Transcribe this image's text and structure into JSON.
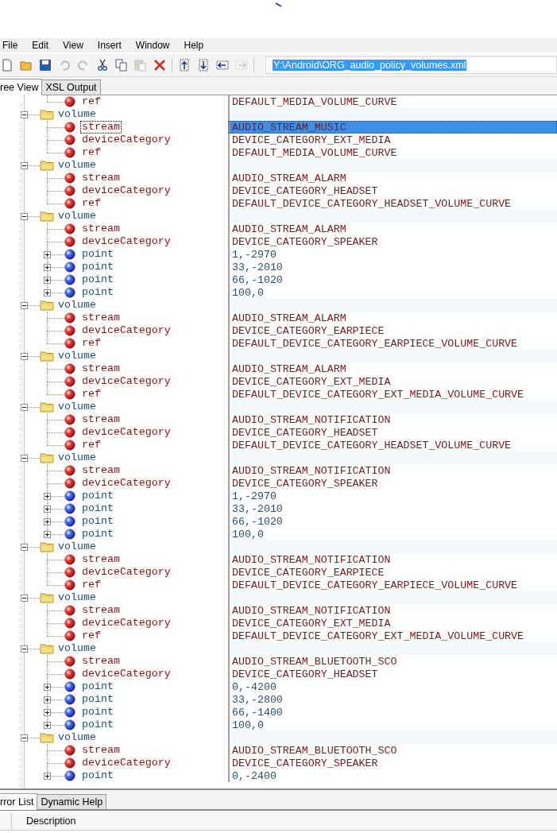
{
  "menu": [
    "File",
    "Edit",
    "View",
    "Insert",
    "Window",
    "Help"
  ],
  "toolbar": {
    "buttons": [
      {
        "kind": "new",
        "disabled": false
      },
      {
        "kind": "open",
        "disabled": false
      },
      {
        "kind": "save",
        "disabled": false
      },
      {
        "kind": "undo",
        "disabled": true
      },
      {
        "kind": "redo",
        "disabled": true
      },
      {
        "kind": "cut",
        "disabled": false
      },
      {
        "kind": "copy",
        "disabled": false
      },
      {
        "kind": "paste",
        "disabled": true
      },
      {
        "kind": "delete",
        "disabled": false
      },
      {
        "kind": "sep"
      },
      {
        "kind": "up",
        "disabled": false
      },
      {
        "kind": "down",
        "disabled": false
      },
      {
        "kind": "indent",
        "disabled": false
      },
      {
        "kind": "outdent",
        "disabled": true
      }
    ],
    "path": "Y:\\Android\\ORG_audio_policy_volumes.xml"
  },
  "tabs": [
    {
      "label": "ree View",
      "selected": true
    },
    {
      "label": "XSL Output",
      "selected": false
    }
  ],
  "tree": {
    "continued_children": [
      {
        "kind": "attribute",
        "label": "ref",
        "value": "DEFAULT_MEDIA_VOLUME_CURVE",
        "selected": false
      }
    ],
    "items": [
      {
        "label": "volume",
        "expanded": true,
        "selected": false,
        "children": [
          {
            "kind": "attribute",
            "label": "stream",
            "value": "AUDIO_STREAM_MUSIC",
            "selected": true
          },
          {
            "kind": "attribute",
            "label": "deviceCategory",
            "value": "DEVICE_CATEGORY_EXT_MEDIA",
            "selected": false
          },
          {
            "kind": "attribute",
            "label": "ref",
            "value": "DEFAULT_MEDIA_VOLUME_CURVE",
            "selected": false
          }
        ]
      },
      {
        "label": "volume",
        "expanded": true,
        "selected": false,
        "children": [
          {
            "kind": "attribute",
            "label": "stream",
            "value": "AUDIO_STREAM_ALARM",
            "selected": false
          },
          {
            "kind": "attribute",
            "label": "deviceCategory",
            "value": "DEVICE_CATEGORY_HEADSET",
            "selected": false
          },
          {
            "kind": "attribute",
            "label": "ref",
            "value": "DEFAULT_DEVICE_CATEGORY_HEADSET_VOLUME_CURVE",
            "selected": false
          }
        ]
      },
      {
        "label": "volume",
        "expanded": true,
        "selected": false,
        "children": [
          {
            "kind": "attribute",
            "label": "stream",
            "value": "AUDIO_STREAM_ALARM",
            "selected": false
          },
          {
            "kind": "attribute",
            "label": "deviceCategory",
            "value": "DEVICE_CATEGORY_SPEAKER",
            "selected": false
          },
          {
            "kind": "element",
            "label": "point",
            "value": "1,-2970",
            "expanded": false,
            "selected": false
          },
          {
            "kind": "element",
            "label": "point",
            "value": "33,-2010",
            "expanded": false,
            "selected": false
          },
          {
            "kind": "element",
            "label": "point",
            "value": "66,-1020",
            "expanded": false,
            "selected": false
          },
          {
            "kind": "element",
            "label": "point",
            "value": "100,0",
            "expanded": false,
            "selected": false
          }
        ]
      },
      {
        "label": "volume",
        "expanded": true,
        "selected": false,
        "children": [
          {
            "kind": "attribute",
            "label": "stream",
            "value": "AUDIO_STREAM_ALARM",
            "selected": false
          },
          {
            "kind": "attribute",
            "label": "deviceCategory",
            "value": "DEVICE_CATEGORY_EARPIECE",
            "selected": false
          },
          {
            "kind": "attribute",
            "label": "ref",
            "value": "DEFAULT_DEVICE_CATEGORY_EARPIECE_VOLUME_CURVE",
            "selected": false
          }
        ]
      },
      {
        "label": "volume",
        "expanded": true,
        "selected": false,
        "children": [
          {
            "kind": "attribute",
            "label": "stream",
            "value": "AUDIO_STREAM_ALARM",
            "selected": false
          },
          {
            "kind": "attribute",
            "label": "deviceCategory",
            "value": "DEVICE_CATEGORY_EXT_MEDIA",
            "selected": false
          },
          {
            "kind": "attribute",
            "label": "ref",
            "value": "DEFAULT_DEVICE_CATEGORY_EXT_MEDIA_VOLUME_CURVE",
            "selected": false
          }
        ]
      },
      {
        "label": "volume",
        "expanded": true,
        "selected": false,
        "children": [
          {
            "kind": "attribute",
            "label": "stream",
            "value": "AUDIO_STREAM_NOTIFICATION",
            "selected": false
          },
          {
            "kind": "attribute",
            "label": "deviceCategory",
            "value": "DEVICE_CATEGORY_HEADSET",
            "selected": false
          },
          {
            "kind": "attribute",
            "label": "ref",
            "value": "DEFAULT_DEVICE_CATEGORY_HEADSET_VOLUME_CURVE",
            "selected": false
          }
        ]
      },
      {
        "label": "volume",
        "expanded": true,
        "selected": false,
        "children": [
          {
            "kind": "attribute",
            "label": "stream",
            "value": "AUDIO_STREAM_NOTIFICATION",
            "selected": false
          },
          {
            "kind": "attribute",
            "label": "deviceCategory",
            "value": "DEVICE_CATEGORY_SPEAKER",
            "selected": false
          },
          {
            "kind": "element",
            "label": "point",
            "value": "1,-2970",
            "expanded": false,
            "selected": false
          },
          {
            "kind": "element",
            "label": "point",
            "value": "33,-2010",
            "expanded": false,
            "selected": false
          },
          {
            "kind": "element",
            "label": "point",
            "value": "66,-1020",
            "expanded": false,
            "selected": false
          },
          {
            "kind": "element",
            "label": "point",
            "value": "100,0",
            "expanded": false,
            "selected": false
          }
        ]
      },
      {
        "label": "volume",
        "expanded": true,
        "selected": false,
        "children": [
          {
            "kind": "attribute",
            "label": "stream",
            "value": "AUDIO_STREAM_NOTIFICATION",
            "selected": false
          },
          {
            "kind": "attribute",
            "label": "deviceCategory",
            "value": "DEVICE_CATEGORY_EARPIECE",
            "selected": false
          },
          {
            "kind": "attribute",
            "label": "ref",
            "value": "DEFAULT_DEVICE_CATEGORY_EARPIECE_VOLUME_CURVE",
            "selected": false
          }
        ]
      },
      {
        "label": "volume",
        "expanded": true,
        "selected": false,
        "children": [
          {
            "kind": "attribute",
            "label": "stream",
            "value": "AUDIO_STREAM_NOTIFICATION",
            "selected": false
          },
          {
            "kind": "attribute",
            "label": "deviceCategory",
            "value": "DEVICE_CATEGORY_EXT_MEDIA",
            "selected": false
          },
          {
            "kind": "attribute",
            "label": "ref",
            "value": "DEFAULT_DEVICE_CATEGORY_EXT_MEDIA_VOLUME_CURVE",
            "selected": false
          }
        ]
      },
      {
        "label": "volume",
        "expanded": true,
        "selected": false,
        "children": [
          {
            "kind": "attribute",
            "label": "stream",
            "value": "AUDIO_STREAM_BLUETOOTH_SCO",
            "selected": false
          },
          {
            "kind": "attribute",
            "label": "deviceCategory",
            "value": "DEVICE_CATEGORY_HEADSET",
            "selected": false
          },
          {
            "kind": "element",
            "label": "point",
            "value": "0,-4200",
            "expanded": false,
            "selected": false
          },
          {
            "kind": "element",
            "label": "point",
            "value": "33,-2800",
            "expanded": false,
            "selected": false
          },
          {
            "kind": "element",
            "label": "point",
            "value": "66,-1400",
            "expanded": false,
            "selected": false
          },
          {
            "kind": "element",
            "label": "point",
            "value": "100,0",
            "expanded": false,
            "selected": false
          }
        ]
      },
      {
        "label": "volume",
        "expanded": true,
        "selected": false,
        "children": [
          {
            "kind": "attribute",
            "label": "stream",
            "value": "AUDIO_STREAM_BLUETOOTH_SCO",
            "selected": false
          },
          {
            "kind": "attribute",
            "label": "deviceCategory",
            "value": "DEVICE_CATEGORY_SPEAKER",
            "selected": false
          },
          {
            "kind": "element",
            "label": "point",
            "value": "0,-2400",
            "expanded": false,
            "selected": false
          }
        ]
      }
    ]
  },
  "bottom_tabs": [
    {
      "label": "rror List",
      "selected": true
    },
    {
      "label": "Dynamic Help",
      "selected": false
    }
  ],
  "error_list": {
    "columns": [
      "Description"
    ]
  }
}
